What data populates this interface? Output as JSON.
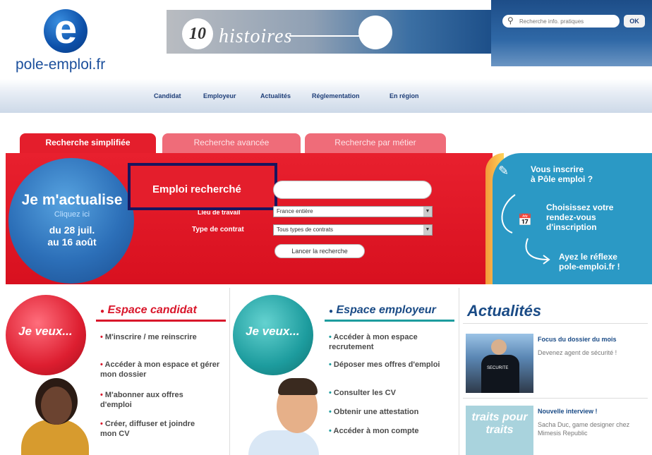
{
  "header": {
    "logo_letter": "e",
    "logo_text": "pole-emploi.fr",
    "banner_number": "10",
    "banner_text": "histoires",
    "search_placeholder": "Recherche info. pratiques",
    "search_ok": "OK"
  },
  "nav": {
    "items": [
      "Candidat",
      "Employeur",
      "Actualités",
      "Réglementation",
      "En région"
    ]
  },
  "search": {
    "tabs": [
      "Recherche simplifiée",
      "Recherche avancée",
      "Recherche par métier"
    ],
    "actualise_title": "Je m'actualise",
    "actualise_sub": "Cliquez ici",
    "actualise_dates_line1": "du 28 juil.",
    "actualise_dates_line2": "au 16 août",
    "emploi_label": "Emploi recherché",
    "emploi_value": "",
    "lieu_label": "Lieu de travail",
    "lieu_value": "France entière",
    "type_label": "Type de contrat",
    "type_value": "Tous types de contrats",
    "button": "Lancer la recherche"
  },
  "promo": {
    "line1a": "Vous inscrire",
    "line1b": "à Pôle emploi ?",
    "line2a": "Choisissez votre",
    "line2b": "rendez-vous",
    "line2c": "d'inscription",
    "line3a": "Ayez le réflexe",
    "line3b": "pole-emploi.fr !",
    "colors": {
      "red": "#e41e2c",
      "blue": "#2b99c5",
      "orange": "#f29a3a"
    }
  },
  "candidat": {
    "ball_text": "Je veux...",
    "title": "Espace candidat",
    "items": [
      "M'inscrire / me reinscrire",
      "Accéder à mon espace et gérer mon dossier",
      "M'abonner aux offres d'emploi",
      "Créer, diffuser et joindre mon CV"
    ]
  },
  "employeur": {
    "ball_text": "Je veux...",
    "title": "Espace employeur",
    "items": [
      "Accéder à mon espace recrutement",
      "Déposer mes offres d'emploi",
      "Consulter les CV",
      "Obtenir une attestation",
      "Accéder à mon compte"
    ]
  },
  "actualites": {
    "title": "Actualités",
    "news": [
      {
        "title": "Focus du dossier du mois",
        "desc": "Devenez agent de sécurité !",
        "image_caption": "SECURITE"
      },
      {
        "title": "Nouvelle interview !",
        "desc": "Sacha Duc, game designer chez Mimesis Republic",
        "image_caption": "traits pour traits"
      }
    ]
  }
}
